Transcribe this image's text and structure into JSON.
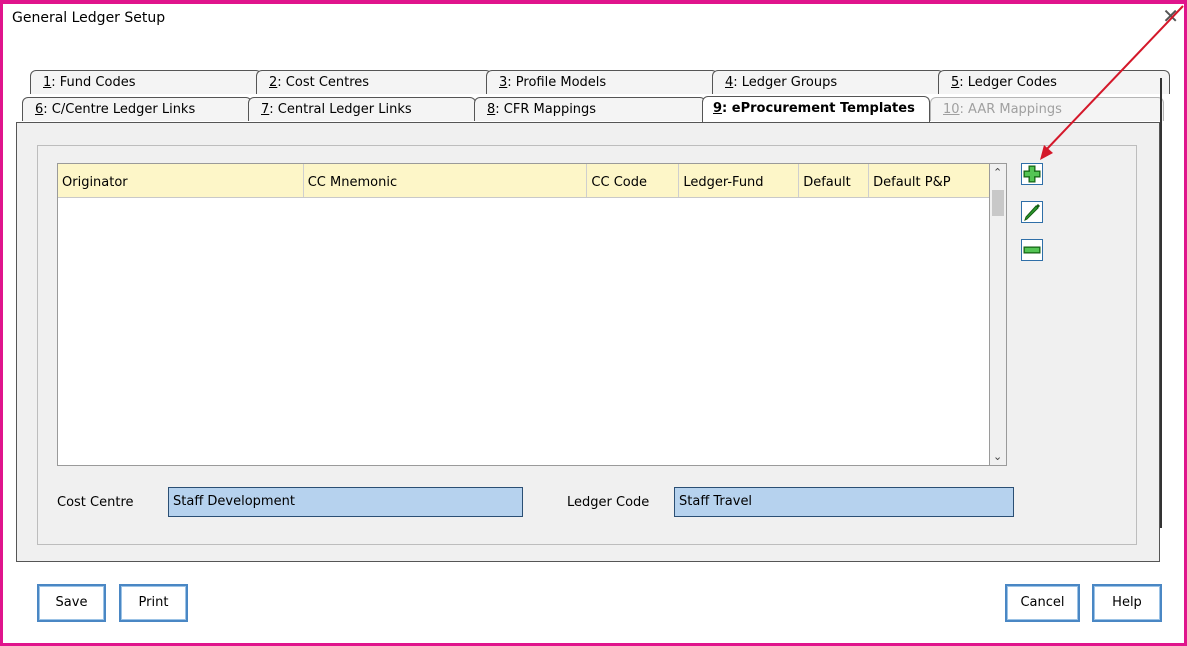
{
  "window": {
    "title": "General Ledger Setup",
    "close_glyph": "✕"
  },
  "tabs_row1": [
    {
      "key": "1",
      "label": ": Fund Codes"
    },
    {
      "key": "2",
      "label": ": Cost Centres"
    },
    {
      "key": "3",
      "label": ": Profile Models"
    },
    {
      "key": "4",
      "label": ": Ledger Groups"
    },
    {
      "key": "5",
      "label": ": Ledger Codes"
    }
  ],
  "tabs_row2": [
    {
      "key": "6",
      "label": ": C/Centre Ledger Links"
    },
    {
      "key": "7",
      "label": ": Central Ledger Links"
    },
    {
      "key": "8",
      "label": ": CFR Mappings"
    },
    {
      "key": "9",
      "label": ": eProcurement Templates"
    },
    {
      "key": "10",
      "label": ": AAR Mappings"
    }
  ],
  "grid": {
    "columns": [
      "Originator",
      "CC Mnemonic",
      "CC Code",
      "Ledger-Fund",
      "Default",
      "Default P&P"
    ],
    "rows": []
  },
  "tools": {
    "add_icon": "plus-icon",
    "edit_icon": "pencil-icon",
    "remove_icon": "minus-icon"
  },
  "cost_centre": {
    "label": "Cost Centre",
    "value": "Staff Development"
  },
  "ledger_code": {
    "label": "Ledger Code",
    "value": "Staff Travel"
  },
  "buttons": {
    "save": "Save",
    "print": "Print",
    "cancel": "Cancel",
    "help": "Help"
  },
  "colors": {
    "annotation": "#e0148c",
    "arrow": "#d4182a",
    "field_bg": "#b6d2ee",
    "header_bg": "#fdf6c8"
  }
}
